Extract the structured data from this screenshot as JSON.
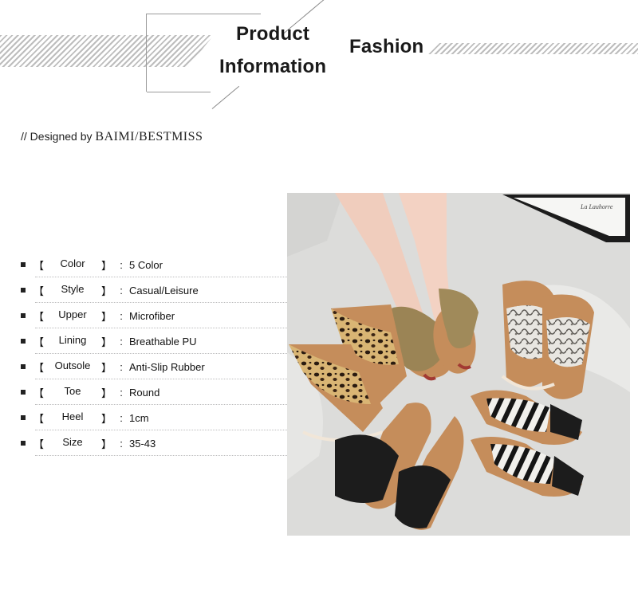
{
  "header": {
    "title_line1": "Product",
    "title_line2": "Information",
    "title_right": "Fashion"
  },
  "designed": {
    "prefix": "// Designed by",
    "brand": "BAIMI/BESTMISS"
  },
  "specs": [
    {
      "label": "Color",
      "value": "5 Color"
    },
    {
      "label": "Style",
      "value": "Casual/Leisure"
    },
    {
      "label": "Upper",
      "value": "Microfiber"
    },
    {
      "label": "Lining",
      "value": "Breathable PU"
    },
    {
      "label": "Outsole",
      "value": "Anti-Slip Rubber"
    },
    {
      "label": "Toe",
      "value": "Round"
    },
    {
      "label": "Heel",
      "value": "1cm"
    },
    {
      "label": "Size",
      "value": "35-43"
    }
  ],
  "brackets": {
    "open": "【",
    "close": "】",
    "colon": ":"
  },
  "photo": {
    "frame_text": "La Lauhorre"
  },
  "colors": {
    "accent_text": "#1a1a1a",
    "stripe": "#bdbdbd",
    "divider": "#bcbcbd"
  }
}
